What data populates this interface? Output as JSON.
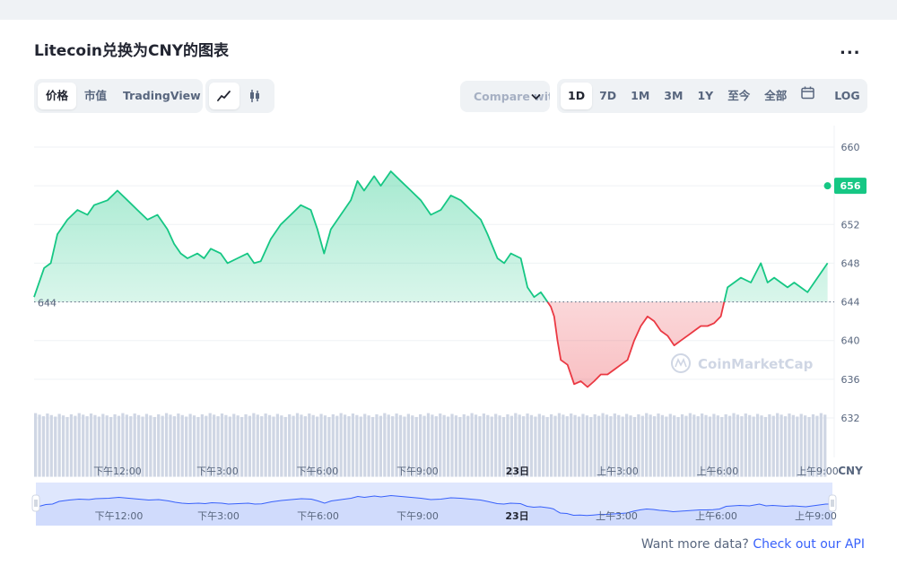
{
  "header": {
    "title": "Litecoin兑换为CNY的图表",
    "more_label": "..."
  },
  "toolbar": {
    "type_options": [
      "价格",
      "市值",
      "TradingView"
    ],
    "active_type": "价格",
    "chart_style_icons": [
      "line-chart-icon",
      "candlestick-icon"
    ],
    "compare_label": "Compare with",
    "range_options": [
      "1D",
      "7D",
      "1M",
      "3M",
      "1Y",
      "至今",
      "全部"
    ],
    "active_range": "1D",
    "calendar_icon": "calendar-icon",
    "log_label": "LOG"
  },
  "colors": {
    "up": "#16c784",
    "down": "#ea3943",
    "up_fill": "#16c784",
    "down_fill": "#ea3943",
    "volume": "#cfd6e4",
    "navigator_line": "#3861fb",
    "navigator_fill": "#dfe7fd"
  },
  "watermark": "CoinMarketCap",
  "footer": {
    "text": "Want more data?",
    "link": "Check out our API"
  },
  "chart_data": {
    "type": "line",
    "y_unit": "CNY",
    "ylim": [
      630,
      662
    ],
    "y_ticks": [
      660,
      656,
      652,
      648,
      644,
      640,
      636,
      632
    ],
    "baseline": 644,
    "baseline_label": "644",
    "current_value": 656,
    "current_label": "656",
    "x_range_hours": [
      9.5,
      33.5
    ],
    "x_ticks": [
      {
        "label": "下午12:00",
        "h": 12
      },
      {
        "label": "下午3:00",
        "h": 15
      },
      {
        "label": "下午6:00",
        "h": 18
      },
      {
        "label": "下午9:00",
        "h": 21
      },
      {
        "label": "23日",
        "h": 24,
        "bold": true
      },
      {
        "label": "上午3:00",
        "h": 27
      },
      {
        "label": "上午6:00",
        "h": 30
      },
      {
        "label": "上午9:00",
        "h": 33
      }
    ],
    "series": [
      {
        "values": [
          [
            9.5,
            644.5
          ],
          [
            9.8,
            647.5
          ],
          [
            10.0,
            648.0
          ],
          [
            10.2,
            651.0
          ],
          [
            10.5,
            652.5
          ],
          [
            10.8,
            653.5
          ],
          [
            11.1,
            653.0
          ],
          [
            11.3,
            654.0
          ],
          [
            11.7,
            654.5
          ],
          [
            12.0,
            655.5
          ],
          [
            12.3,
            654.5
          ],
          [
            12.6,
            653.5
          ],
          [
            12.9,
            652.5
          ],
          [
            13.2,
            653.0
          ],
          [
            13.5,
            651.5
          ],
          [
            13.7,
            650.0
          ],
          [
            13.9,
            649.0
          ],
          [
            14.1,
            648.5
          ],
          [
            14.4,
            649.0
          ],
          [
            14.6,
            648.5
          ],
          [
            14.8,
            649.5
          ],
          [
            15.1,
            649.0
          ],
          [
            15.3,
            648.0
          ],
          [
            15.6,
            648.5
          ],
          [
            15.9,
            649.0
          ],
          [
            16.1,
            648.0
          ],
          [
            16.3,
            648.2
          ],
          [
            16.6,
            650.5
          ],
          [
            16.9,
            652.0
          ],
          [
            17.2,
            653.0
          ],
          [
            17.5,
            654.0
          ],
          [
            17.8,
            653.5
          ],
          [
            18.0,
            651.5
          ],
          [
            18.2,
            649.0
          ],
          [
            18.4,
            651.5
          ],
          [
            18.7,
            653.0
          ],
          [
            19.0,
            654.5
          ],
          [
            19.2,
            656.5
          ],
          [
            19.4,
            655.5
          ],
          [
            19.7,
            657.0
          ],
          [
            19.9,
            656.0
          ],
          [
            20.2,
            657.5
          ],
          [
            20.5,
            656.5
          ],
          [
            20.8,
            655.5
          ],
          [
            21.1,
            654.5
          ],
          [
            21.4,
            653.0
          ],
          [
            21.7,
            653.5
          ],
          [
            22.0,
            655.0
          ],
          [
            22.3,
            654.5
          ],
          [
            22.6,
            653.5
          ],
          [
            22.9,
            652.5
          ],
          [
            23.1,
            651.0
          ],
          [
            23.4,
            648.5
          ],
          [
            23.6,
            648.0
          ],
          [
            23.8,
            649.0
          ],
          [
            24.1,
            648.5
          ],
          [
            24.3,
            645.5
          ],
          [
            24.5,
            644.5
          ],
          [
            24.7,
            645.0
          ],
          [
            24.8,
            644.5
          ],
          [
            25.0,
            643.5
          ],
          [
            25.1,
            642.5
          ],
          [
            25.2,
            640.0
          ],
          [
            25.3,
            638.0
          ],
          [
            25.5,
            637.5
          ],
          [
            25.7,
            635.5
          ],
          [
            25.9,
            635.8
          ],
          [
            26.1,
            635.2
          ],
          [
            26.3,
            635.8
          ],
          [
            26.5,
            636.5
          ],
          [
            26.7,
            636.5
          ],
          [
            26.9,
            637.0
          ],
          [
            27.1,
            637.5
          ],
          [
            27.3,
            638.0
          ],
          [
            27.5,
            640.0
          ],
          [
            27.7,
            641.5
          ],
          [
            27.9,
            642.5
          ],
          [
            28.1,
            642.0
          ],
          [
            28.3,
            641.0
          ],
          [
            28.5,
            640.5
          ],
          [
            28.7,
            639.5
          ],
          [
            28.9,
            640.0
          ],
          [
            29.1,
            640.5
          ],
          [
            29.3,
            641.0
          ],
          [
            29.5,
            641.5
          ],
          [
            29.7,
            641.5
          ],
          [
            29.9,
            641.8
          ],
          [
            30.1,
            642.5
          ],
          [
            30.3,
            645.5
          ],
          [
            30.5,
            646.0
          ],
          [
            30.7,
            646.5
          ],
          [
            31.0,
            646.0
          ],
          [
            31.3,
            648.0
          ],
          [
            31.5,
            646.0
          ],
          [
            31.7,
            646.5
          ],
          [
            31.9,
            646.0
          ],
          [
            32.1,
            645.5
          ],
          [
            32.3,
            646.0
          ],
          [
            32.5,
            645.5
          ],
          [
            32.7,
            645.0
          ],
          [
            32.9,
            646.0
          ],
          [
            33.1,
            647.0
          ],
          [
            33.3,
            648.0
          ]
        ]
      }
    ],
    "volume": {
      "bars": 200,
      "min": 630,
      "max": 632.5
    }
  }
}
